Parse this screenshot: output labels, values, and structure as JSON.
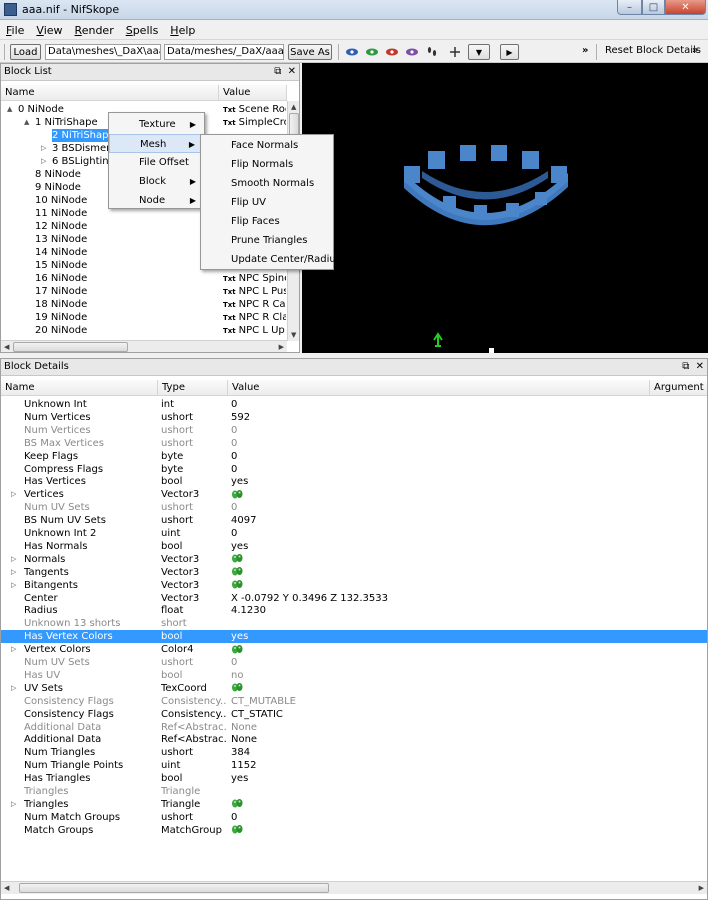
{
  "window": {
    "title": "aaa.nif - NifSkope",
    "min": "–",
    "max": "□",
    "close": "✕"
  },
  "menu": [
    "File",
    "View",
    "Render",
    "Spells",
    "Help"
  ],
  "toolbar": {
    "load_label": "Load",
    "load_path": "Data\\meshes\\_DaX\\aaa.nif",
    "save_path": "Data/meshes/_DaX/aaa.nif",
    "save_label": "Save As",
    "more": "»",
    "reset_label": "Reset Block Details",
    "more2": "»"
  },
  "block_list": {
    "title": "Block List",
    "col_name": "Name",
    "col_value": "Value",
    "rows": [
      {
        "name": "0 NiNode",
        "value": "Scene Roo",
        "txt": "Txt",
        "indent": 0,
        "expander": "▲"
      },
      {
        "name": "1 NiTriShape",
        "value": "SimpleCro",
        "txt": "Txt",
        "indent": 1,
        "expander": "▲"
      },
      {
        "name": "2 NiTriShap",
        "value": "",
        "txt": "",
        "indent": 2,
        "expander": "",
        "selected": true
      },
      {
        "name": "3 BSDismer",
        "value": "",
        "txt": "",
        "indent": 2,
        "expander": "▷"
      },
      {
        "name": "6 BSLightin",
        "value": "",
        "txt": "",
        "indent": 2,
        "expander": "▷"
      },
      {
        "name": "8 NiNode",
        "value": "",
        "txt": "",
        "indent": 1,
        "expander": ""
      },
      {
        "name": "9 NiNode",
        "value": "",
        "txt": "",
        "indent": 1,
        "expander": ""
      },
      {
        "name": "10 NiNode",
        "value": "",
        "txt": "",
        "indent": 1,
        "expander": ""
      },
      {
        "name": "11 NiNode",
        "value": "",
        "txt": "",
        "indent": 1,
        "expander": ""
      },
      {
        "name": "12 NiNode",
        "value": "",
        "txt": "",
        "indent": 1,
        "expander": ""
      },
      {
        "name": "13 NiNode",
        "value": "",
        "txt": "",
        "indent": 1,
        "expander": ""
      },
      {
        "name": "14 NiNode",
        "value": "",
        "txt": "",
        "indent": 1,
        "expander": ""
      },
      {
        "name": "15 NiNode",
        "value": "",
        "txt": "",
        "indent": 1,
        "expander": ""
      },
      {
        "name": "16 NiNode",
        "value": "NPC Spine",
        "txt": "Txt",
        "indent": 1,
        "expander": ""
      },
      {
        "name": "17 NiNode",
        "value": "NPC L Pus",
        "txt": "Txt",
        "indent": 1,
        "expander": ""
      },
      {
        "name": "18 NiNode",
        "value": "NPC R Cal",
        "txt": "Txt",
        "indent": 1,
        "expander": ""
      },
      {
        "name": "19 NiNode",
        "value": "NPC R Cla",
        "txt": "Txt",
        "indent": 1,
        "expander": ""
      },
      {
        "name": "20 NiNode",
        "value": "NPC L Up",
        "txt": "Txt",
        "indent": 1,
        "expander": ""
      }
    ]
  },
  "context_menu": {
    "items": [
      "Texture",
      "Mesh",
      "File Offset",
      "Block",
      "Node"
    ],
    "arrow": "▶",
    "submenu": [
      "Face Normals",
      "Flip Normals",
      "Smooth Normals",
      "Flip UV",
      "Flip Faces",
      "Prune Triangles",
      "Update Center/Radius"
    ]
  },
  "block_details": {
    "title": "Block Details",
    "col_name": "Name",
    "col_type": "Type",
    "col_value": "Value",
    "col_argument": "Argument",
    "rows": [
      {
        "name": "Unknown Int",
        "type": "int",
        "value": "0",
        "gray": false,
        "exp": false,
        "icon": false
      },
      {
        "name": "Num Vertices",
        "type": "ushort",
        "value": "592",
        "gray": false,
        "exp": false,
        "icon": false
      },
      {
        "name": "Num Vertices",
        "type": "ushort",
        "value": "0",
        "gray": true,
        "exp": false,
        "icon": false
      },
      {
        "name": "BS Max Vertices",
        "type": "ushort",
        "value": "0",
        "gray": true,
        "exp": false,
        "icon": false
      },
      {
        "name": "Keep Flags",
        "type": "byte",
        "value": "0",
        "gray": false,
        "exp": false,
        "icon": false
      },
      {
        "name": "Compress Flags",
        "type": "byte",
        "value": "0",
        "gray": false,
        "exp": false,
        "icon": false
      },
      {
        "name": "Has Vertices",
        "type": "bool",
        "value": "yes",
        "gray": false,
        "exp": false,
        "icon": false
      },
      {
        "name": "Vertices",
        "type": "Vector3",
        "value": "",
        "gray": false,
        "exp": true,
        "icon": true
      },
      {
        "name": "Num UV Sets",
        "type": "ushort",
        "value": "0",
        "gray": true,
        "exp": false,
        "icon": false
      },
      {
        "name": "BS Num UV Sets",
        "type": "ushort",
        "value": "4097",
        "gray": false,
        "exp": false,
        "icon": false
      },
      {
        "name": "Unknown Int 2",
        "type": "uint",
        "value": "0",
        "gray": false,
        "exp": false,
        "icon": false
      },
      {
        "name": "Has Normals",
        "type": "bool",
        "value": "yes",
        "gray": false,
        "exp": false,
        "icon": false
      },
      {
        "name": "Normals",
        "type": "Vector3",
        "value": "",
        "gray": false,
        "exp": true,
        "icon": true
      },
      {
        "name": "Tangents",
        "type": "Vector3",
        "value": "",
        "gray": false,
        "exp": true,
        "icon": true
      },
      {
        "name": "Bitangents",
        "type": "Vector3",
        "value": "",
        "gray": false,
        "exp": true,
        "icon": true
      },
      {
        "name": "Center",
        "type": "Vector3",
        "value": "X -0.0792 Y 0.3496 Z 132.3533",
        "gray": false,
        "exp": false,
        "icon": false
      },
      {
        "name": "Radius",
        "type": "float",
        "value": "4.1230",
        "gray": false,
        "exp": false,
        "icon": false
      },
      {
        "name": "Unknown 13 shorts",
        "type": "short",
        "value": "",
        "gray": true,
        "exp": false,
        "icon": false
      },
      {
        "name": "Has Vertex Colors",
        "type": "bool",
        "value": "yes",
        "gray": false,
        "exp": false,
        "icon": false,
        "selected": true
      },
      {
        "name": "Vertex Colors",
        "type": "Color4",
        "value": "",
        "gray": false,
        "exp": true,
        "icon": true
      },
      {
        "name": "Num UV Sets",
        "type": "ushort",
        "value": "0",
        "gray": true,
        "exp": false,
        "icon": false
      },
      {
        "name": "Has UV",
        "type": "bool",
        "value": "no",
        "gray": true,
        "exp": false,
        "icon": false
      },
      {
        "name": "UV Sets",
        "type": "TexCoord",
        "value": "",
        "gray": false,
        "exp": true,
        "icon": true
      },
      {
        "name": "Consistency Flags",
        "type": "Consistency...",
        "value": "CT_MUTABLE",
        "gray": true,
        "exp": false,
        "icon": false
      },
      {
        "name": "Consistency Flags",
        "type": "Consistency...",
        "value": "CT_STATIC",
        "gray": false,
        "exp": false,
        "icon": false
      },
      {
        "name": "Additional Data",
        "type": "Ref<Abstrac...",
        "value": "None",
        "gray": true,
        "exp": false,
        "icon": false
      },
      {
        "name": "Additional Data",
        "type": "Ref<Abstrac...",
        "value": "None",
        "gray": false,
        "exp": false,
        "icon": false
      },
      {
        "name": "Num Triangles",
        "type": "ushort",
        "value": "384",
        "gray": false,
        "exp": false,
        "icon": false
      },
      {
        "name": "Num Triangle Points",
        "type": "uint",
        "value": "1152",
        "gray": false,
        "exp": false,
        "icon": false
      },
      {
        "name": "Has Triangles",
        "type": "bool",
        "value": "yes",
        "gray": false,
        "exp": false,
        "icon": false
      },
      {
        "name": "Triangles",
        "type": "Triangle",
        "value": "",
        "gray": true,
        "exp": false,
        "icon": false
      },
      {
        "name": "Triangles",
        "type": "Triangle",
        "value": "",
        "gray": false,
        "exp": true,
        "icon": true
      },
      {
        "name": "Num Match Groups",
        "type": "ushort",
        "value": "0",
        "gray": false,
        "exp": false,
        "icon": false
      },
      {
        "name": "Match Groups",
        "type": "MatchGroup",
        "value": "",
        "gray": false,
        "exp": false,
        "icon": true
      }
    ]
  },
  "colors": {
    "selection": "#3399ff",
    "mesh": "#4a86c9",
    "viewport_bg": "#000000",
    "gizmo": "#22cc22"
  }
}
